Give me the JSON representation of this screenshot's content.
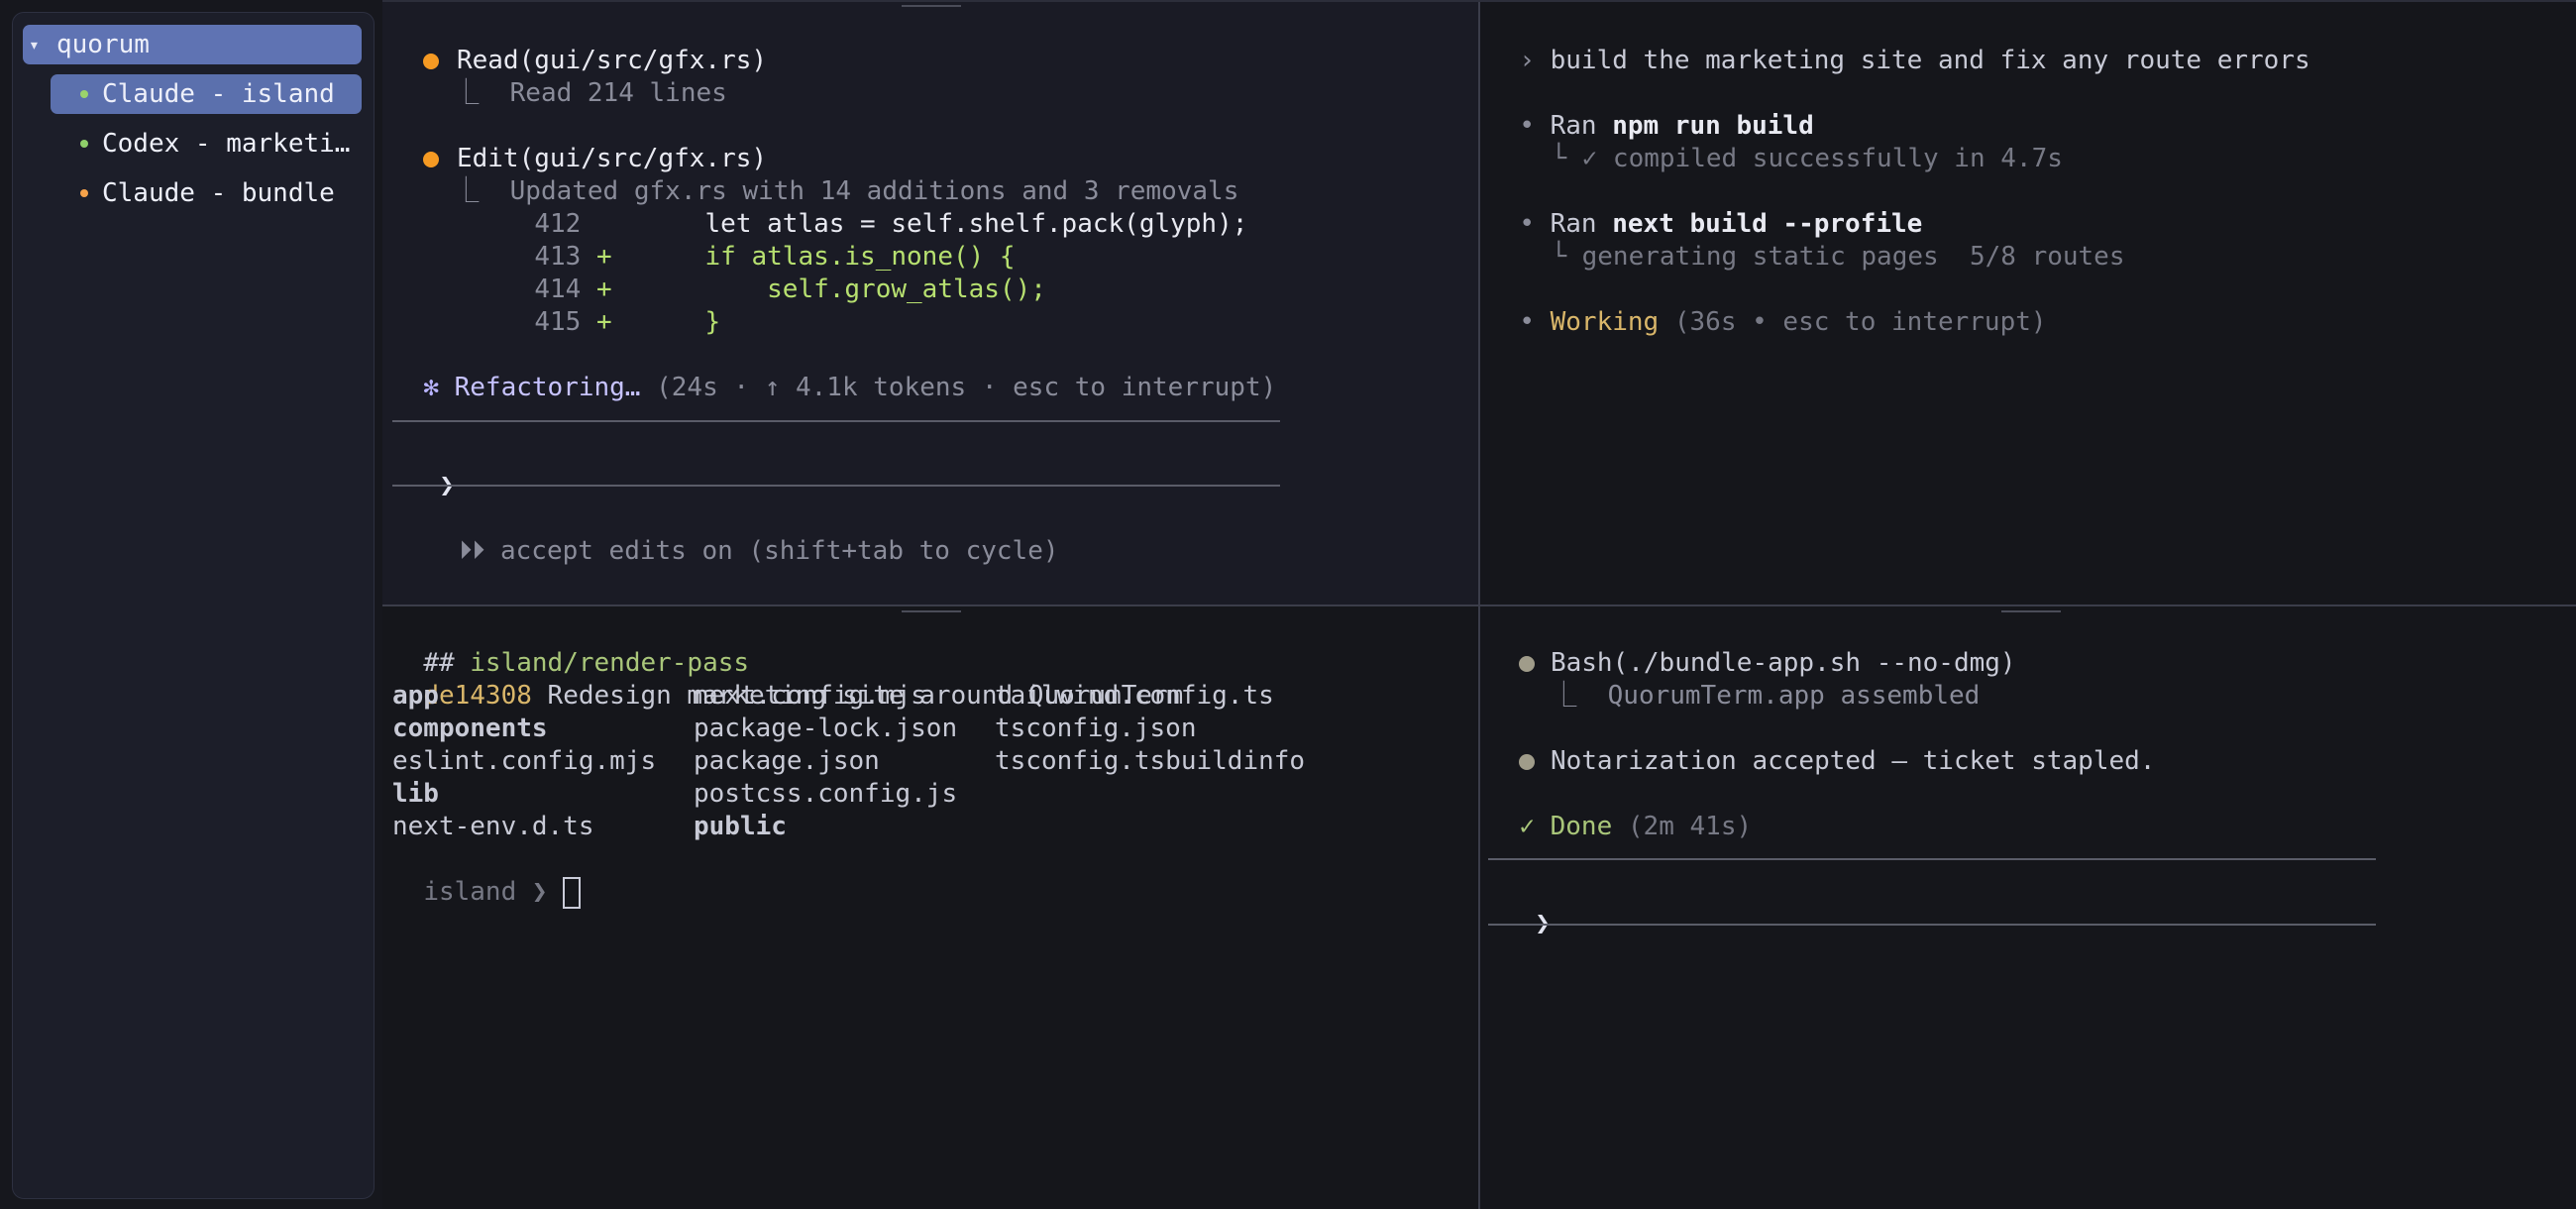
{
  "sidebar": {
    "root": {
      "chevron": "▾",
      "label": "quorum"
    },
    "items": [
      {
        "label": "Claude - island",
        "dot_color": "#9bd36b"
      },
      {
        "label": "Codex - marketi…",
        "dot_color": "#8fcf6a"
      },
      {
        "label": "Claude - bundle",
        "dot_color": "#f5a24a"
      }
    ]
  },
  "pane_top_left": {
    "read_call": "Read(gui/src/gfx.rs)",
    "read_result_prefix": "⎿",
    "read_result": "Read 214 lines",
    "edit_call": "Edit(gui/src/gfx.rs)",
    "edit_result_prefix": "⎿",
    "edit_result": "Updated gfx.rs with 14 additions and 3 removals",
    "diff": [
      {
        "num": "412",
        "sign": "",
        "code": "    let atlas = self.shelf.pack(glyph);"
      },
      {
        "num": "413",
        "sign": "+",
        "code": "    if atlas.is_none() {"
      },
      {
        "num": "414",
        "sign": "+",
        "code": "        self.grow_atlas();"
      },
      {
        "num": "415",
        "sign": "+",
        "code": "    }"
      }
    ],
    "status_star": "✻",
    "status_word": "Refactoring…",
    "status_detail": "(24s · ↑ 4.1k tokens · esc to interrupt)",
    "prompt_symbol": "❯",
    "mode_icon": "⏵⏵",
    "mode_text": "accept edits on (shift+tab to cycle)"
  },
  "pane_top_right": {
    "user_prompt_symbol": "›",
    "user_prompt": "build the marketing site and fix any route errors",
    "steps": [
      {
        "bullet": "•",
        "prefix": "Ran",
        "command": "npm run build",
        "detail_prefix": "└",
        "detail": "✓ compiled successfully in 4.7s"
      },
      {
        "bullet": "•",
        "prefix": "Ran",
        "command": "next build --profile",
        "detail_prefix": "└",
        "detail": "generating static pages  5/8 routes"
      }
    ],
    "working_bullet": "•",
    "working_word": "Working",
    "working_detail": "(36s • esc to interrupt)"
  },
  "pane_bottom_left": {
    "branch_prefix": "##",
    "branch": "island/render-pass",
    "commit_hash": "de14308",
    "commit_message": "Redesign marketing site around QuorumTerm",
    "files": [
      [
        "app",
        "next.config.mjs",
        "tailwind.config.ts"
      ],
      [
        "components",
        "package-lock.json",
        "tsconfig.json"
      ],
      [
        "eslint.config.mjs",
        "package.json",
        "tsconfig.tsbuildinfo"
      ],
      [
        "lib",
        "postcss.config.js",
        ""
      ],
      [
        "next-env.d.ts",
        "public",
        ""
      ]
    ],
    "dirs": [
      "app",
      "components",
      "lib",
      "public"
    ],
    "shell_prompt": "island ❯"
  },
  "pane_bottom_right": {
    "bash_call": "Bash(./bundle-app.sh --no-dmg)",
    "bash_result_prefix": "⎿",
    "bash_result": "QuorumTerm.app assembled",
    "notarization": "Notarization accepted — ticket stapled.",
    "done_check": "✓",
    "done_word": "Done",
    "done_detail": "(2m 41s)",
    "prompt_symbol": "❯"
  }
}
